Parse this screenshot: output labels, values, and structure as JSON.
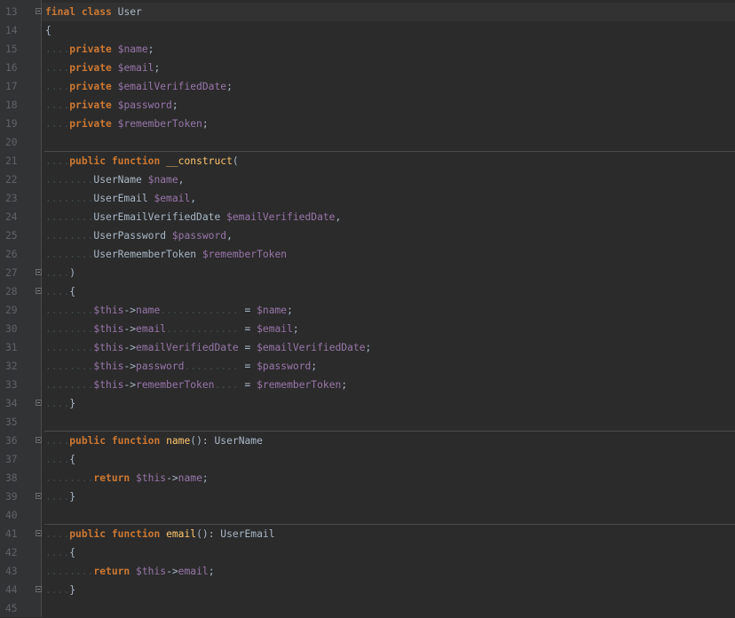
{
  "editor": {
    "lines": [
      {
        "n": "13",
        "tokens": [
          [
            "kw",
            "final"
          ],
          [
            "p",
            " "
          ],
          [
            "kw",
            "class"
          ],
          [
            "p",
            " User"
          ]
        ]
      },
      {
        "n": "14",
        "tokens": [
          [
            "p",
            "{"
          ]
        ]
      },
      {
        "n": "15",
        "tokens": [
          [
            "ws",
            "...."
          ],
          [
            "kw",
            "private"
          ],
          [
            "p",
            " "
          ],
          [
            "var",
            "$name"
          ],
          [
            "p",
            ";"
          ]
        ]
      },
      {
        "n": "16",
        "tokens": [
          [
            "ws",
            "...."
          ],
          [
            "kw",
            "private"
          ],
          [
            "p",
            " "
          ],
          [
            "var",
            "$email"
          ],
          [
            "p",
            ";"
          ]
        ]
      },
      {
        "n": "17",
        "tokens": [
          [
            "ws",
            "...."
          ],
          [
            "kw",
            "private"
          ],
          [
            "p",
            " "
          ],
          [
            "var",
            "$emailVerifiedDate"
          ],
          [
            "p",
            ";"
          ]
        ]
      },
      {
        "n": "18",
        "tokens": [
          [
            "ws",
            "...."
          ],
          [
            "kw",
            "private"
          ],
          [
            "p",
            " "
          ],
          [
            "var",
            "$password"
          ],
          [
            "p",
            ";"
          ]
        ]
      },
      {
        "n": "19",
        "tokens": [
          [
            "ws",
            "...."
          ],
          [
            "kw",
            "private"
          ],
          [
            "p",
            " "
          ],
          [
            "var",
            "$rememberToken"
          ],
          [
            "p",
            ";"
          ]
        ]
      },
      {
        "n": "20",
        "tokens": []
      },
      {
        "n": "21",
        "tokens": [
          [
            "ws",
            "...."
          ],
          [
            "kw",
            "public"
          ],
          [
            "p",
            " "
          ],
          [
            "kw",
            "function"
          ],
          [
            "p",
            " "
          ],
          [
            "fn",
            "__construct"
          ],
          [
            "p",
            "("
          ]
        ]
      },
      {
        "n": "22",
        "tokens": [
          [
            "ws",
            "........"
          ],
          [
            "ty",
            "UserName"
          ],
          [
            "p",
            " "
          ],
          [
            "var",
            "$name"
          ],
          [
            "p",
            ","
          ]
        ]
      },
      {
        "n": "23",
        "tokens": [
          [
            "ws",
            "........"
          ],
          [
            "ty",
            "UserEmail"
          ],
          [
            "p",
            " "
          ],
          [
            "var",
            "$email"
          ],
          [
            "p",
            ","
          ]
        ]
      },
      {
        "n": "24",
        "tokens": [
          [
            "ws",
            "........"
          ],
          [
            "ty",
            "UserEmailVerifiedDate"
          ],
          [
            "p",
            " "
          ],
          [
            "var",
            "$emailVerifiedDate"
          ],
          [
            "p",
            ","
          ]
        ]
      },
      {
        "n": "25",
        "tokens": [
          [
            "ws",
            "........"
          ],
          [
            "ty",
            "UserPassword"
          ],
          [
            "p",
            " "
          ],
          [
            "var",
            "$password"
          ],
          [
            "p",
            ","
          ]
        ]
      },
      {
        "n": "26",
        "tokens": [
          [
            "ws",
            "........"
          ],
          [
            "ty",
            "UserRememberToken"
          ],
          [
            "p",
            " "
          ],
          [
            "var",
            "$rememberToken"
          ]
        ]
      },
      {
        "n": "27",
        "tokens": [
          [
            "ws",
            "...."
          ],
          [
            "p",
            ")"
          ]
        ]
      },
      {
        "n": "28",
        "tokens": [
          [
            "ws",
            "...."
          ],
          [
            "p",
            "{"
          ]
        ]
      },
      {
        "n": "29",
        "tokens": [
          [
            "ws",
            "........"
          ],
          [
            "var",
            "$this"
          ],
          [
            "p",
            "->"
          ],
          [
            "var",
            "name"
          ],
          [
            "ws",
            "............."
          ],
          [
            "p",
            " = "
          ],
          [
            "var",
            "$name"
          ],
          [
            "p",
            ";"
          ]
        ]
      },
      {
        "n": "30",
        "tokens": [
          [
            "ws",
            "........"
          ],
          [
            "var",
            "$this"
          ],
          [
            "p",
            "->"
          ],
          [
            "var",
            "email"
          ],
          [
            "ws",
            "............"
          ],
          [
            "p",
            " = "
          ],
          [
            "var",
            "$email"
          ],
          [
            "p",
            ";"
          ]
        ]
      },
      {
        "n": "31",
        "tokens": [
          [
            "ws",
            "........"
          ],
          [
            "var",
            "$this"
          ],
          [
            "p",
            "->"
          ],
          [
            "var",
            "emailVerifiedDate"
          ],
          [
            "p",
            " = "
          ],
          [
            "var",
            "$emailVerifiedDate"
          ],
          [
            "p",
            ";"
          ]
        ]
      },
      {
        "n": "32",
        "tokens": [
          [
            "ws",
            "........"
          ],
          [
            "var",
            "$this"
          ],
          [
            "p",
            "->"
          ],
          [
            "var",
            "password"
          ],
          [
            "ws",
            "........."
          ],
          [
            "p",
            " = "
          ],
          [
            "var",
            "$password"
          ],
          [
            "p",
            ";"
          ]
        ]
      },
      {
        "n": "33",
        "tokens": [
          [
            "ws",
            "........"
          ],
          [
            "var",
            "$this"
          ],
          [
            "p",
            "->"
          ],
          [
            "var",
            "rememberToken"
          ],
          [
            "ws",
            "...."
          ],
          [
            "p",
            " = "
          ],
          [
            "var",
            "$rememberToken"
          ],
          [
            "p",
            ";"
          ]
        ]
      },
      {
        "n": "34",
        "tokens": [
          [
            "ws",
            "...."
          ],
          [
            "p",
            "}"
          ]
        ]
      },
      {
        "n": "35",
        "tokens": []
      },
      {
        "n": "36",
        "tokens": [
          [
            "ws",
            "...."
          ],
          [
            "kw",
            "public"
          ],
          [
            "p",
            " "
          ],
          [
            "kw",
            "function"
          ],
          [
            "p",
            " "
          ],
          [
            "fn",
            "name"
          ],
          [
            "p",
            "(): UserName"
          ]
        ]
      },
      {
        "n": "37",
        "tokens": [
          [
            "ws",
            "...."
          ],
          [
            "p",
            "{"
          ]
        ]
      },
      {
        "n": "38",
        "tokens": [
          [
            "ws",
            "........"
          ],
          [
            "kw",
            "return"
          ],
          [
            "p",
            " "
          ],
          [
            "var",
            "$this"
          ],
          [
            "p",
            "->"
          ],
          [
            "var",
            "name"
          ],
          [
            "p",
            ";"
          ]
        ]
      },
      {
        "n": "39",
        "tokens": [
          [
            "ws",
            "...."
          ],
          [
            "p",
            "}"
          ]
        ]
      },
      {
        "n": "40",
        "tokens": []
      },
      {
        "n": "41",
        "tokens": [
          [
            "ws",
            "...."
          ],
          [
            "kw",
            "public"
          ],
          [
            "p",
            " "
          ],
          [
            "kw",
            "function"
          ],
          [
            "p",
            " "
          ],
          [
            "fn",
            "email"
          ],
          [
            "p",
            "(): UserEmail"
          ]
        ]
      },
      {
        "n": "42",
        "tokens": [
          [
            "ws",
            "...."
          ],
          [
            "p",
            "{"
          ]
        ]
      },
      {
        "n": "43",
        "tokens": [
          [
            "ws",
            "........"
          ],
          [
            "kw",
            "return"
          ],
          [
            "p",
            " "
          ],
          [
            "var",
            "$this"
          ],
          [
            "p",
            "->"
          ],
          [
            "var",
            "email"
          ],
          [
            "p",
            ";"
          ]
        ]
      },
      {
        "n": "44",
        "tokens": [
          [
            "ws",
            "...."
          ],
          [
            "p",
            "}"
          ]
        ]
      },
      {
        "n": "45",
        "tokens": []
      }
    ],
    "fold_markers": [
      "13",
      "27",
      "28",
      "34",
      "36",
      "39",
      "41",
      "44"
    ],
    "separators_after": [
      "20",
      "35",
      "40"
    ],
    "current_line": "13",
    "colors": {
      "background": "#2b2b2b",
      "gutter": "#313335",
      "line_number": "#606366",
      "keyword": "#cc7832",
      "variable": "#9876aa",
      "function": "#ffc66d",
      "text": "#a9b7c6",
      "whitespace": "#3e4a50"
    },
    "fold_icon": "fold-toggle-icon"
  }
}
